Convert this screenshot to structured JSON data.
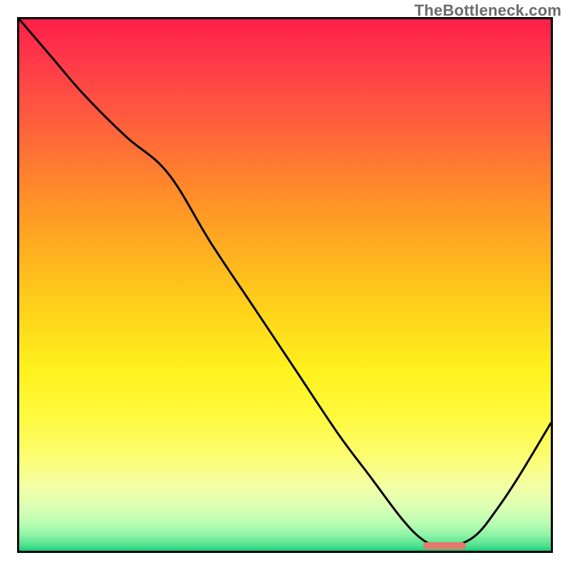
{
  "watermark": "TheBottleneck.com",
  "chart_data": {
    "type": "line",
    "title": "",
    "xlabel": "",
    "ylabel": "",
    "xlim": [
      0,
      100
    ],
    "ylim": [
      0,
      100
    ],
    "grid": false,
    "series": [
      {
        "name": "curve",
        "x": [
          0,
          6,
          12,
          20,
          28,
          36,
          44,
          52,
          60,
          66,
          72,
          76,
          79,
          82,
          86,
          90,
          94,
          100
        ],
        "values": [
          100,
          93,
          86,
          78,
          71,
          58,
          46,
          34,
          22,
          14,
          6,
          2,
          1,
          1,
          3,
          8,
          14,
          24
        ]
      }
    ],
    "minimum_band": {
      "x_start": 76,
      "x_end": 84,
      "y": 1
    },
    "colors": {
      "curve": "#000000",
      "min_marker": "#e4796e",
      "gradient_top": "#ff1f4a",
      "gradient_bottom": "#18cf79"
    }
  }
}
